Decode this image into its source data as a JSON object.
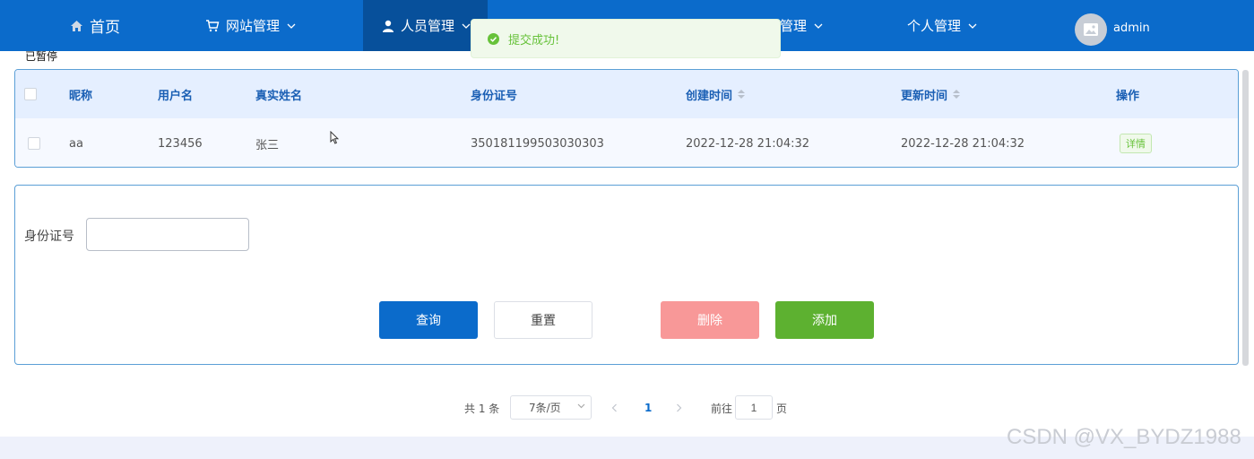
{
  "nav": {
    "home": "首页",
    "website_mgmt": "网站管理",
    "people_mgmt": "人员管理",
    "hidden_mgmt": "管理",
    "personal_mgmt": "个人管理",
    "username": "admin",
    "brand_color": "#0b6bcb"
  },
  "toast": {
    "message": "提交成功!",
    "color": "#67c23a"
  },
  "status_text": "已暂停",
  "table": {
    "headers": {
      "nickname": "昵称",
      "username": "用户名",
      "realname": "真实姓名",
      "idnumber": "身份证号",
      "created": "创建时间",
      "updated": "更新时间",
      "actions": "操作"
    },
    "rows": [
      {
        "nickname": "aa",
        "username": "123456",
        "realname": "张三",
        "idnumber": "350181199503030303",
        "created": "2022-12-28 21:04:32",
        "updated": "2022-12-28 21:04:32",
        "action": "详情"
      }
    ]
  },
  "search": {
    "id_label": "身份证号",
    "id_value": "",
    "query_label": "查询",
    "reset_label": "重置",
    "delete_label": "删除",
    "add_label": "添加"
  },
  "pagination": {
    "total": "共 1 条",
    "page_size": "7条/页",
    "current_page": "1",
    "goto_label": "前往",
    "goto_value": "1",
    "page_suffix": "页"
  },
  "watermark": "CSDN @VX_BYDZ1988"
}
